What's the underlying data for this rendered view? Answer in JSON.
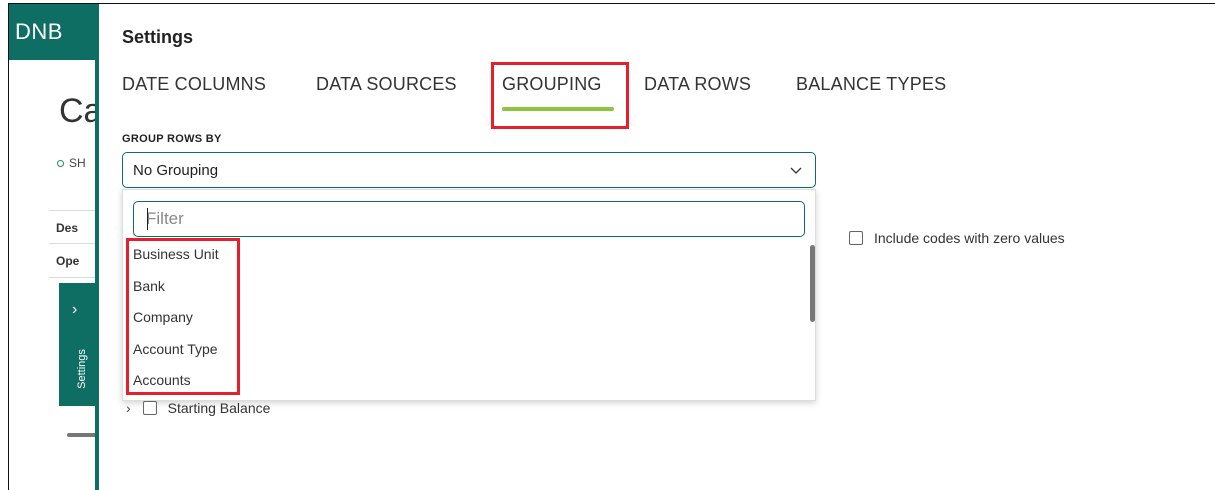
{
  "brand": {
    "logo": "DNB",
    "color": "#0f6e63",
    "accent": "#8cc43a",
    "highlight": "#e5202a"
  },
  "background": {
    "title_fragment": "Ca",
    "status_fragment": "SH",
    "rows": [
      "Des",
      "Ope"
    ],
    "side_tab": {
      "label": "Settings",
      "icon": "chevron-right-icon"
    }
  },
  "settings": {
    "title": "Settings",
    "tabs": [
      {
        "label": "DATE COLUMNS",
        "active": false
      },
      {
        "label": "DATA SOURCES",
        "active": false
      },
      {
        "label": "GROUPING",
        "active": true
      },
      {
        "label": "DATA ROWS",
        "active": false
      },
      {
        "label": "BALANCE TYPES",
        "active": false
      }
    ],
    "group_rows_by": {
      "label": "GROUP ROWS BY",
      "selected": "No Grouping",
      "filter_placeholder": "Filter",
      "options": [
        "Business Unit",
        "Bank",
        "Company",
        "Account Type",
        "Accounts"
      ]
    },
    "include_zero": {
      "label": "Include codes with zero values",
      "checked": false
    },
    "starting_balance": {
      "label": "Starting Balance",
      "checked": false
    }
  }
}
